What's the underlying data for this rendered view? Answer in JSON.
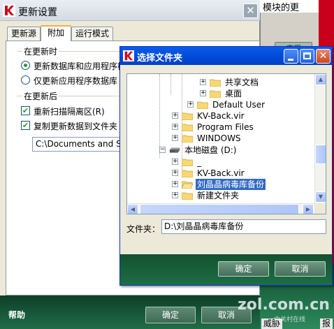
{
  "background_window": {
    "title": "模块的更",
    "apply_button": "应用",
    "bottom_labels": [
      "威胁",
      "报"
    ]
  },
  "main_dialog": {
    "title": "更新设置",
    "tabs": [
      {
        "label": "更新源",
        "active": false
      },
      {
        "label": "附加",
        "active": true
      },
      {
        "label": "运行模式",
        "active": false
      }
    ],
    "group_on_update": "在更新时",
    "radio_options": [
      {
        "label": "更新数据库和应用程序模块",
        "checked": true
      },
      {
        "label": "仅更新应用程序数据库",
        "checked": false
      }
    ],
    "group_after_update": "在更新后",
    "checkbox_options": [
      {
        "label": "重新扫描隔离区(R)",
        "checked": true
      },
      {
        "label": "复制更新数据到文件夹",
        "checked": true
      }
    ],
    "copy_path_value": "C:\\Documents and Settings",
    "help_label": "帮助",
    "ok_button": "确定",
    "cancel_button": "取消"
  },
  "folder_dialog": {
    "title": "选择文件夹",
    "tree_items": [
      {
        "label": "共享文档",
        "icon": "folder-icon",
        "expander": "+",
        "level": 2
      },
      {
        "label": "桌面",
        "icon": "folder-icon",
        "expander": "+",
        "level": 2
      },
      {
        "label": "Default User",
        "icon": "folder-icon",
        "expander": "+",
        "level": 1
      },
      {
        "label": "KV-Back.vir",
        "icon": "folder-icon",
        "expander": "+",
        "level": 0
      },
      {
        "label": "Program Files",
        "icon": "folder-icon",
        "expander": "+",
        "level": 0
      },
      {
        "label": "WINDOWS",
        "icon": "folder-icon",
        "expander": "+",
        "level": 0
      },
      {
        "label": "本地磁盘 (D:)",
        "icon": "drive-icon",
        "expander": "−",
        "level": -1
      },
      {
        "label": "_",
        "icon": "folder-icon",
        "expander": "+",
        "level": 0
      },
      {
        "label": "KV-Back.vir",
        "icon": "folder-icon",
        "expander": "+",
        "level": 0
      },
      {
        "label": "刘晶晶病毒库备份",
        "icon": "folder-icon",
        "expander": "+",
        "level": 0,
        "selected": true
      },
      {
        "label": "新建文件夹",
        "icon": "folder-icon",
        "expander": "+",
        "level": 0
      }
    ],
    "folder_label": "文件夹：",
    "folder_value": "D:\\刘晶晶病毒库备份",
    "ok_button": "确定",
    "cancel_button": "取消"
  },
  "watermark": {
    "text": "zol.com.cn",
    "subtext": "中关村在线"
  },
  "colors": {
    "xp_blue": "#0049d6",
    "selection": "#316ac5",
    "footer_green": "#1e6e45",
    "brand_red": "#c8001c"
  }
}
